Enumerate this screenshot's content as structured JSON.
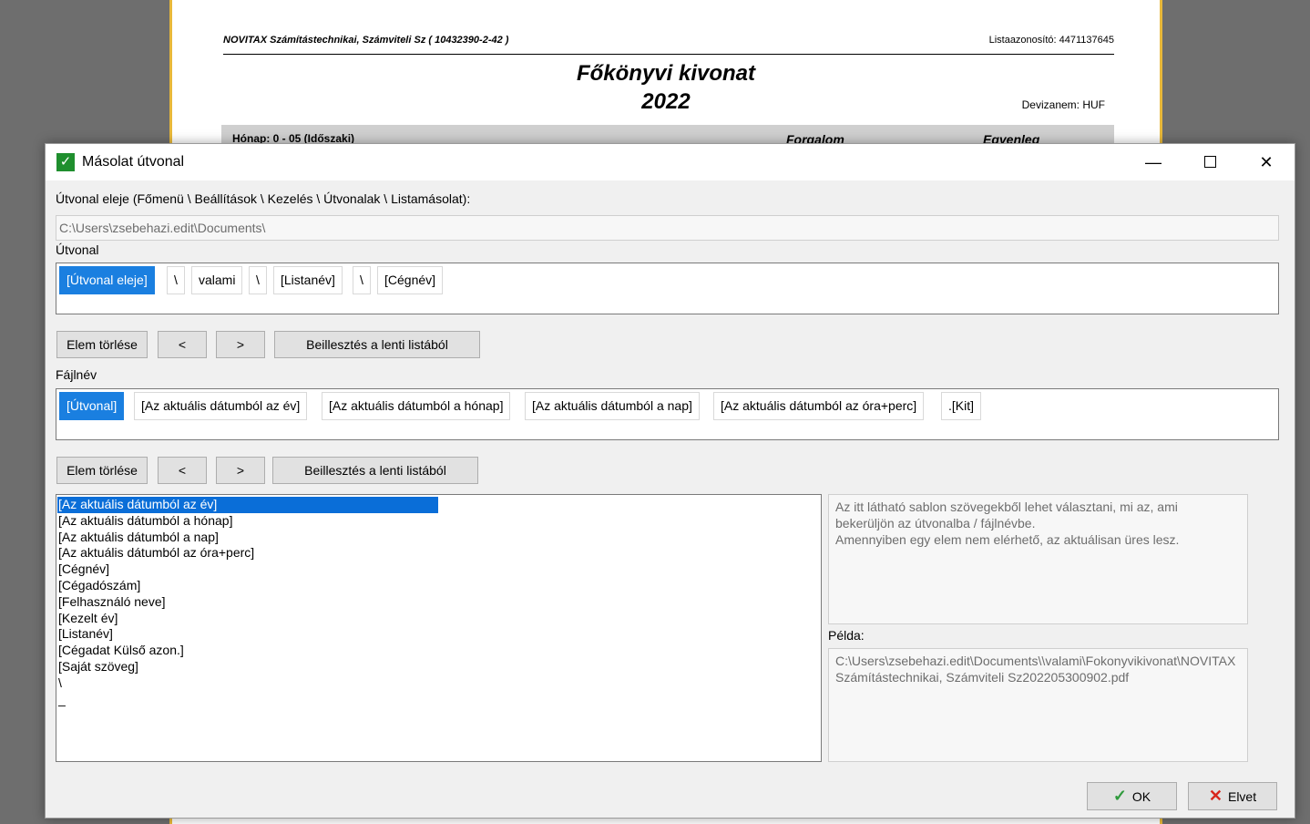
{
  "report": {
    "company": "NOVITAX Számítástechnikai, Számviteli Sz ( 10432390-2-42 )",
    "list_id": "Listaazonosító: 4471137645",
    "title": "Főkönyvi kivonat",
    "year": "2022",
    "currency": "Devizanem: HUF",
    "band_month": "Hónap: 0 - 05 (Időszaki)",
    "band_turnover": "Forgalom",
    "band_balance": "Egyenleg"
  },
  "dialog": {
    "title": "Másolat útvonal",
    "window_buttons": {
      "minimize": "—",
      "close": "✕"
    },
    "path_start_label": "Útvonal eleje (Főmenü \\ Beállítások \\ Kezelés \\ Útvonalak \\ Listamásolat):",
    "path_start_value": "C:\\Users\\zsebehazi.edit\\Documents\\",
    "route_label": "Útvonal",
    "route_tokens": [
      "[Útvonal eleje]",
      "\\",
      "valami",
      "\\",
      "[Listanév]",
      "\\",
      "[Cégnév]"
    ],
    "filename_label": "Fájlnév",
    "filename_tokens": [
      "[Útvonal]",
      "[Az aktuális dátumból az év]",
      "[Az aktuális dátumból a hónap]",
      "[Az aktuális dátumból a nap]",
      "[Az aktuális dátumból az óra+perc]",
      ".[Kit]"
    ],
    "buttons": {
      "delete": "Elem törlése",
      "left": "<",
      "right": ">",
      "insert": "Beillesztés a lenti listából"
    },
    "template_list": [
      "[Az aktuális dátumból az év]",
      "[Az aktuális dátumból a hónap]",
      "[Az aktuális dátumból a nap]",
      "[Az aktuális dátumból az óra+perc]",
      "[Cégnév]",
      "[Cégadószám]",
      "[Felhasználó neve]",
      "[Kezelt év]",
      "[Listanév]",
      "[Cégadat Külső azon.]",
      "[Saját szöveg]",
      "\\",
      "_"
    ],
    "info_line1": "Az itt látható sablon szövegekből lehet választani, mi az, ami",
    "info_line2": "bekerüljön az útvonalba / fájlnévbe.",
    "info_line3": "Amennyiben egy elem nem elérhető, az aktuálisan üres lesz.",
    "example_label": "Példa:",
    "example_value": "C:\\Users\\zsebehazi.edit\\Documents\\\\valami\\Fokonyvikivonat\\NOVITAX Számítástechnikai, Számviteli Sz202205300902.pdf",
    "ok_label": "OK",
    "cancel_label": "Elvet"
  }
}
